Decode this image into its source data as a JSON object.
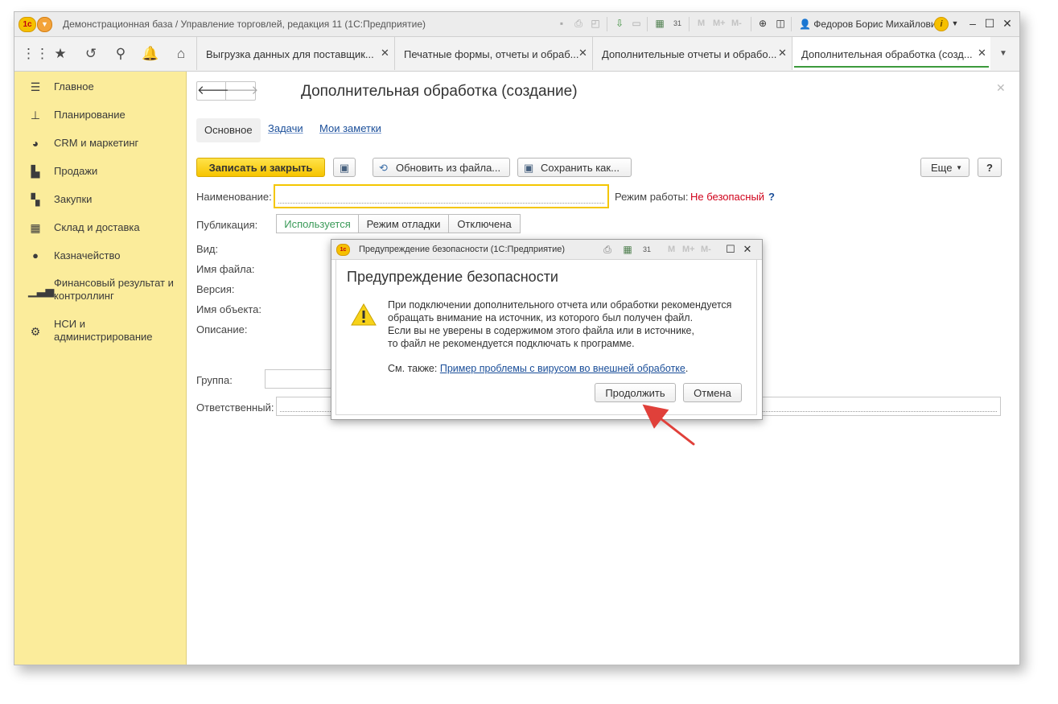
{
  "window": {
    "title": "Демонстрационная база / Управление торговлей, редакция 11  (1С:Предприятие)",
    "user": "Федоров Борис Михайлович",
    "toolbar_labels": [
      "M",
      "M+",
      "M-"
    ]
  },
  "tabs": [
    {
      "label": "Выгрузка данных для поставщик..."
    },
    {
      "label": "Печатные формы, отчеты и обраб..."
    },
    {
      "label": "Дополнительные отчеты и обрабо..."
    },
    {
      "label": "Дополнительная обработка (созд..."
    }
  ],
  "sidebar": {
    "items": [
      {
        "label": "Главное",
        "icon": "menu-icon"
      },
      {
        "label": "Планирование",
        "icon": "planning-icon"
      },
      {
        "label": "CRM и маркетинг",
        "icon": "pie-chart-icon"
      },
      {
        "label": "Продажи",
        "icon": "shopping-bag-icon"
      },
      {
        "label": "Закупки",
        "icon": "cart-icon"
      },
      {
        "label": "Склад и доставка",
        "icon": "warehouse-icon"
      },
      {
        "label": "Казначейство",
        "icon": "ruble-icon"
      },
      {
        "label": "Финансовый результат и контроллинг",
        "icon": "bar-chart-icon"
      },
      {
        "label": "НСИ и администрирование",
        "icon": "gear-icon"
      }
    ]
  },
  "form": {
    "title": "Дополнительная обработка (создание)",
    "tabs": [
      "Основное",
      "Задачи",
      "Мои заметки"
    ],
    "buttons": {
      "save_close": "Записать и закрыть",
      "update_from_file": "Обновить из файла...",
      "save_as": "Сохранить как...",
      "more": "Еще",
      "help": "?"
    },
    "fields": {
      "name_label": "Наименование:",
      "mode_label": "Режим работы:",
      "mode_value": "Не безопасный",
      "mode_help": "?",
      "publication_label": "Публикация:",
      "publication_options": [
        "Используется",
        "Режим отладки",
        "Отключена"
      ],
      "kind_label": "Вид:",
      "filename_label": "Имя файла:",
      "version_label": "Версия:",
      "object_name_label": "Имя объекта:",
      "description_label": "Описание:",
      "group_label": "Группа:",
      "responsible_label": "Ответственный:"
    }
  },
  "dialog": {
    "window_title": "Предупреждение безопасности  (1С:Предприятие)",
    "heading": "Предупреждение безопасности",
    "text_lines": [
      "При подключении дополнительного отчета или обработки рекомендуется",
      "обращать внимание на источник, из которого был получен файл.",
      "Если вы не уверены в содержимом этого файла или в источнике,",
      "то файл не рекомендуется подключать к программе."
    ],
    "see_also": "См. также:",
    "see_also_link": "Пример проблемы с вирусом во внешней обработке",
    "continue": "Продолжить",
    "cancel": "Отмена"
  },
  "colors": {
    "sidebar_bg": "#fbec9b",
    "primary_button": "#f6c400",
    "danger_text": "#d0021b",
    "link": "#1a4e99",
    "active_tab_underline": "#3c9a3c",
    "annotation_arrow": "#e0403a"
  }
}
